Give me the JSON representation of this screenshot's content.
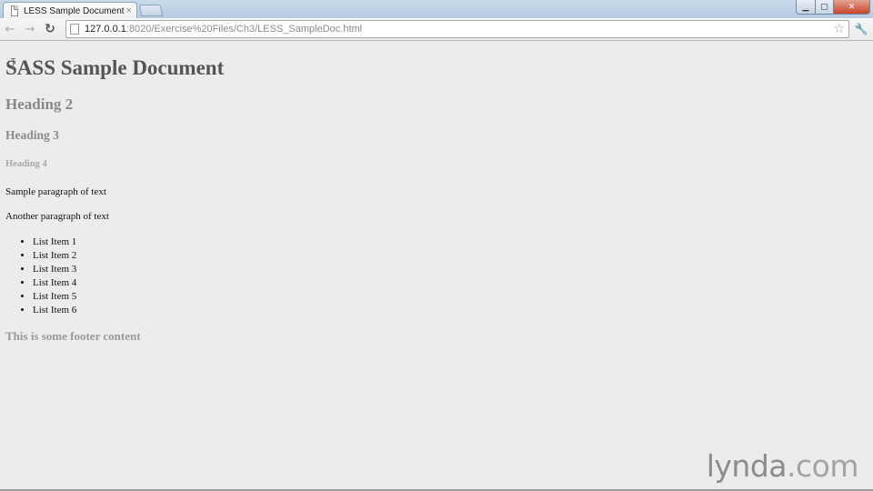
{
  "tab": {
    "title": "LESS Sample Document",
    "close_glyph": "×"
  },
  "window_controls": {
    "minimize": "▁",
    "maximize": "▢",
    "close": "✕"
  },
  "toolbar": {
    "back_glyph": "←",
    "forward_glyph": "→",
    "reload_glyph": "↻",
    "url_host": "127.0.0.1",
    "url_path": ":8020/Exercise%20Files/Ch3/LESS_SampleDoc.html",
    "star_glyph": "☆",
    "wrench_glyph": "🔧"
  },
  "page": {
    "h1": "SASS Sample Document",
    "h2": "Heading 2",
    "h3": "Heading 3",
    "h4": "Heading 4",
    "p1": "Sample paragraph of text",
    "p2": "Another paragraph of text",
    "list": [
      "List Item 1",
      "List Item 2",
      "List Item 3",
      "List Item 4",
      "List Item 5",
      "List Item 6"
    ],
    "footer": "This is some footer content"
  },
  "watermark": {
    "brand": "lynda",
    "suffix": ".com"
  }
}
